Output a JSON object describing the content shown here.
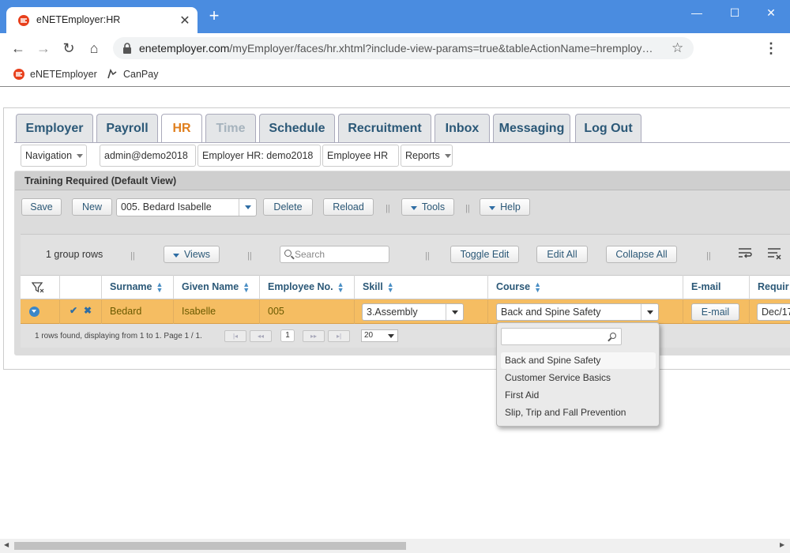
{
  "browser": {
    "tab_title": "eNETEmployer:HR",
    "close_glyph": "✕",
    "new_tab_glyph": "+",
    "url_host": "enetemployer.com",
    "url_path": "/myEmployer/faces/hr.xhtml?include-view-params=true&tableActionName=hremploy…",
    "bookmarks": [
      "eNETEmployer",
      "CanPay"
    ],
    "window_controls": [
      "—",
      "☐",
      "✕"
    ],
    "nav": [
      "←",
      "→",
      "↻",
      "⌂"
    ],
    "star": "☆",
    "menu": "⋮"
  },
  "main_tabs": [
    "Employer",
    "Payroll",
    "HR",
    "Time",
    "Schedule",
    "Recruitment",
    "Inbox",
    "Messaging",
    "Log Out"
  ],
  "nav_bar": {
    "navigation": "Navigation",
    "user": "admin@demo2018",
    "employer": "Employer HR: demo2018",
    "employee": "Employee HR",
    "reports": "Reports"
  },
  "panel_title": "Training Required (Default View)",
  "toolbar": {
    "save": "Save",
    "new": "New",
    "record": "005. Bedard Isabelle",
    "delete": "Delete",
    "reload": "Reload",
    "tools": "Tools",
    "help": "Help",
    "sep": "||"
  },
  "grid_toolbar": {
    "group_rows": "1 group rows",
    "views": "Views",
    "search_placeholder": "Search",
    "toggle_edit": "Toggle Edit",
    "edit_all": "Edit All",
    "collapse_all": "Collapse All"
  },
  "columns": [
    "Surname",
    "Given Name",
    "Employee No.",
    "Skill",
    "Course",
    "E-mail",
    "Requir"
  ],
  "row": {
    "surname": "Bedard",
    "given_name": "Isabelle",
    "employee_no": "005",
    "skill": "3.Assembly",
    "course": "Back and Spine Safety",
    "email_button": "E-mail",
    "required": "Dec/17"
  },
  "pager": {
    "status": "1 rows found, displaying from 1 to 1. Page 1 / 1.",
    "page": "1",
    "page_size": "20",
    "first": "|◂",
    "prev": "◂◂",
    "next": "▸▸",
    "last": "▸|"
  },
  "course_options": [
    "Back and Spine Safety",
    "Customer Service Basics",
    "First Aid",
    "Slip, Trip and Fall Prevention"
  ],
  "colors": {
    "chrome": "#4a8ce0",
    "tab_text": "#2b5877",
    "active_tab": "#e07f1e",
    "selected_row": "#f5bd62"
  }
}
